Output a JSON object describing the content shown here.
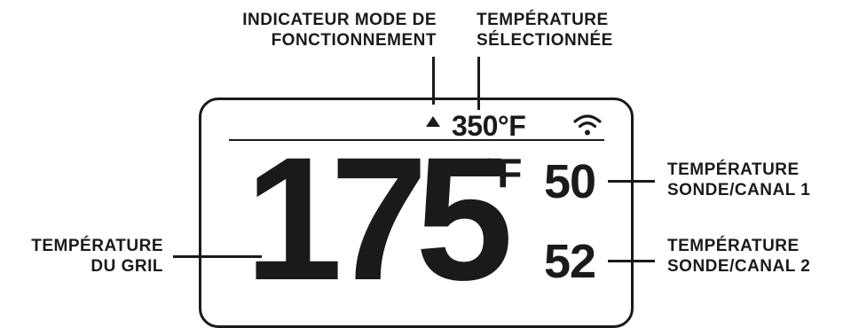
{
  "callouts": {
    "mode_indicator": [
      "INDICATEUR MODE DE",
      "FONCTIONNEMENT"
    ],
    "selected_temp": [
      "TEMPÉRATURE",
      "SÉLECTIONNÉE"
    ],
    "grill_temp": [
      "TEMPÉRATURE",
      "DU GRIL"
    ],
    "probe1_temp": [
      "TEMPÉRATURE",
      "SONDE/CANAL 1"
    ],
    "probe2_temp": [
      "TEMPÉRATURE",
      "SONDE/CANAL 2"
    ]
  },
  "display": {
    "set_temperature": "350°F",
    "grill_temperature": "175",
    "grill_unit": "°F",
    "probe1": "50",
    "probe2": "52"
  },
  "icons": {
    "mode_indicator": "triangle-up-icon",
    "wifi": "wifi-icon"
  },
  "colors": {
    "ink": "#1a1a1a",
    "background": "#ffffff"
  }
}
